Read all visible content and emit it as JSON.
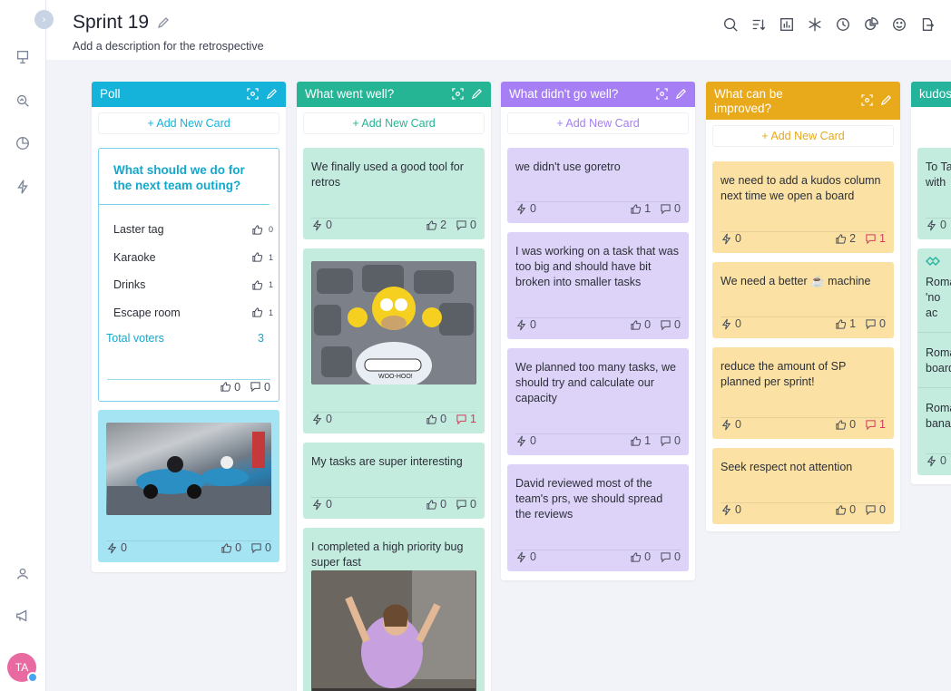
{
  "header": {
    "title": "Sprint 19",
    "description": "Add a description for the retrospective"
  },
  "user": {
    "initials": "TA"
  },
  "colors": {
    "poll": "#15b2d9",
    "went_well": "#25b494",
    "didnt_go_well": "#a57ff3",
    "improve": "#e8a91a",
    "kudos": "#26b39b"
  },
  "icons": {
    "sidebar": [
      "presentation-icon",
      "analytics-icon",
      "pie-chart-icon",
      "lightning-icon",
      "team-icon",
      "megaphone-icon"
    ],
    "toolbar": [
      "search-icon",
      "sort-icon",
      "chart-icon",
      "snowflake-icon",
      "timer-icon",
      "pie-icon",
      "emoji-icon",
      "export-icon"
    ]
  },
  "columns": [
    {
      "title": "Poll",
      "add_label": "+ Add New Card",
      "poll": {
        "question": "What should we do for the next team outing?",
        "options": [
          {
            "label": "Laster tag",
            "votes": "0"
          },
          {
            "label": "Karaoke",
            "votes": "1"
          },
          {
            "label": "Drinks",
            "votes": "1"
          },
          {
            "label": "Escape room",
            "votes": "1"
          }
        ],
        "total_label": "Total voters",
        "total": "3",
        "likes": "0",
        "comments": "0"
      },
      "cards": [
        {
          "text": "",
          "gif": "go-kart-gif",
          "actions": "0",
          "likes": "0",
          "comments": "0"
        }
      ]
    },
    {
      "title": "What went well?",
      "add_label": "+ Add New Card",
      "cards": [
        {
          "text": "We finally used a good tool for retros",
          "actions": "0",
          "likes": "2",
          "comments": "0"
        },
        {
          "text": "",
          "gif": "homer-gif",
          "gif_caption": "WOO-HOO!",
          "actions": "0",
          "likes": "0",
          "comments": "1"
        },
        {
          "text": "My tasks are super interesting",
          "actions": "0",
          "likes": "0",
          "comments": "0"
        },
        {
          "text": "I completed a high priority bug super fast",
          "gif": "celebration-gif"
        }
      ]
    },
    {
      "title": "What didn't go well?",
      "add_label": "+ Add New Card",
      "cards": [
        {
          "text": "we didn't use goretro",
          "actions": "0",
          "likes": "1",
          "comments": "0"
        },
        {
          "text": "I was working on a task that was too big and should have bit broken into smaller tasks",
          "actions": "0",
          "likes": "0",
          "comments": "0"
        },
        {
          "text": "We planned too many tasks, we should try and calculate our capacity",
          "actions": "0",
          "likes": "1",
          "comments": "0"
        },
        {
          "text": "David reviewed most of the team's prs, we should spread the reviews",
          "actions": "0",
          "likes": "0",
          "comments": "0"
        }
      ]
    },
    {
      "title": "What can be improved?",
      "add_label": "+ Add New Card",
      "cards": [
        {
          "text": "we need to add a kudos column next time we open a board",
          "actions": "0",
          "likes": "2",
          "comments": "1"
        },
        {
          "text": "We need a better ☕ machine",
          "actions": "0",
          "likes": "1",
          "comments": "0"
        },
        {
          "text": "reduce the amount of SP planned per sprint!",
          "actions": "0",
          "likes": "0",
          "comments": "1"
        },
        {
          "text": "Seek respect not attention",
          "actions": "0",
          "likes": "0",
          "comments": "0"
        }
      ]
    },
    {
      "title": "kudos",
      "cards": [
        {
          "text": "To Ta with",
          "actions": "0"
        },
        {
          "text": "Roma 'no ac",
          "extra": [
            "Roma board",
            "Roma bana"
          ],
          "actions": "0"
        }
      ]
    }
  ]
}
